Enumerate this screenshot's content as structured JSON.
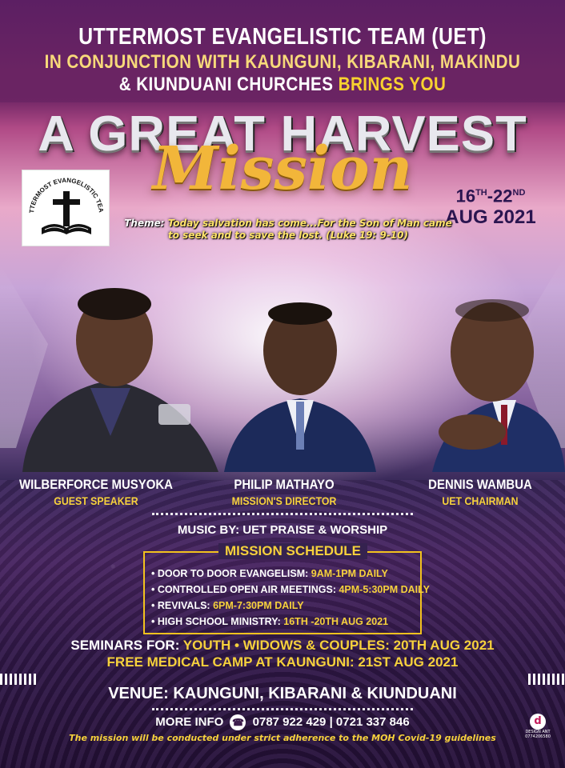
{
  "header": {
    "org": "UTTERMOST EVANGELISTIC TEAM (UET)",
    "conjunction": "IN CONJUNCTION WITH KAUNGUNI, KIBARANI, MAKINDU",
    "churches": "& KIUNDUANI CHURCHES",
    "brings": "BRINGS YOU"
  },
  "title": {
    "main": "A GREAT HARVEST",
    "script": "Mission"
  },
  "logo": {
    "text": "UTTERMOST EVANGELISTIC TEAM",
    "icon": "cross-bible-icon"
  },
  "dates": {
    "start": "16",
    "start_sup": "TH",
    "end": "-22",
    "end_sup": "ND",
    "month_year": "AUG 2021"
  },
  "theme": {
    "label": "Theme:",
    "text": "Today salvation has come...For the Son of Man came to seek and to save the lost. (Luke 19: 9-10)"
  },
  "speakers": [
    {
      "name": "WILBERFORCE MUSYOKA",
      "role": "GUEST SPEAKER"
    },
    {
      "name": "PHILIP MATHAYO",
      "role": "MISSION'S DIRECTOR"
    },
    {
      "name": "DENNIS WAMBUA",
      "role": "UET CHAIRMAN"
    }
  ],
  "music": "MUSIC BY: UET PRAISE & WORSHIP",
  "schedule": {
    "title": "MISSION SCHEDULE",
    "items": [
      {
        "label": "• DOOR TO DOOR EVANGELISM:",
        "time": "9AM-1PM DAILY"
      },
      {
        "label": "• CONTROLLED OPEN AIR MEETINGS:",
        "time": "4PM-5:30PM DAILY"
      },
      {
        "label": "• REVIVALS:",
        "time": "6PM-7:30PM DAILY"
      },
      {
        "label": "• HIGH SCHOOL MINISTRY:",
        "time": "16TH -20TH AUG 2021"
      }
    ]
  },
  "seminars": {
    "label": "SEMINARS FOR:",
    "groups": "YOUTH • WIDOWS & COUPLES: 20TH AUG 2021"
  },
  "medical": "FREE MEDICAL CAMP AT KAUNGUNI: 21ST AUG 2021",
  "venue": "VENUE: KAUNGUNI, KIBARANI & KIUNDUANI",
  "contact": {
    "label": "MORE INFO",
    "icon": "phone-icon",
    "phones": "0787 922 429 | 0721 337 846"
  },
  "covid_note": "The mission will be conducted under strict adherence to the MOH Covid-19 guidelines",
  "designer": {
    "mark": "d",
    "name": "DESIGN ANT",
    "phone": "0774206580"
  },
  "colors": {
    "yellow": "#f6d13c",
    "purple_band": "#5c1f63",
    "gold": "#f2b63a"
  }
}
